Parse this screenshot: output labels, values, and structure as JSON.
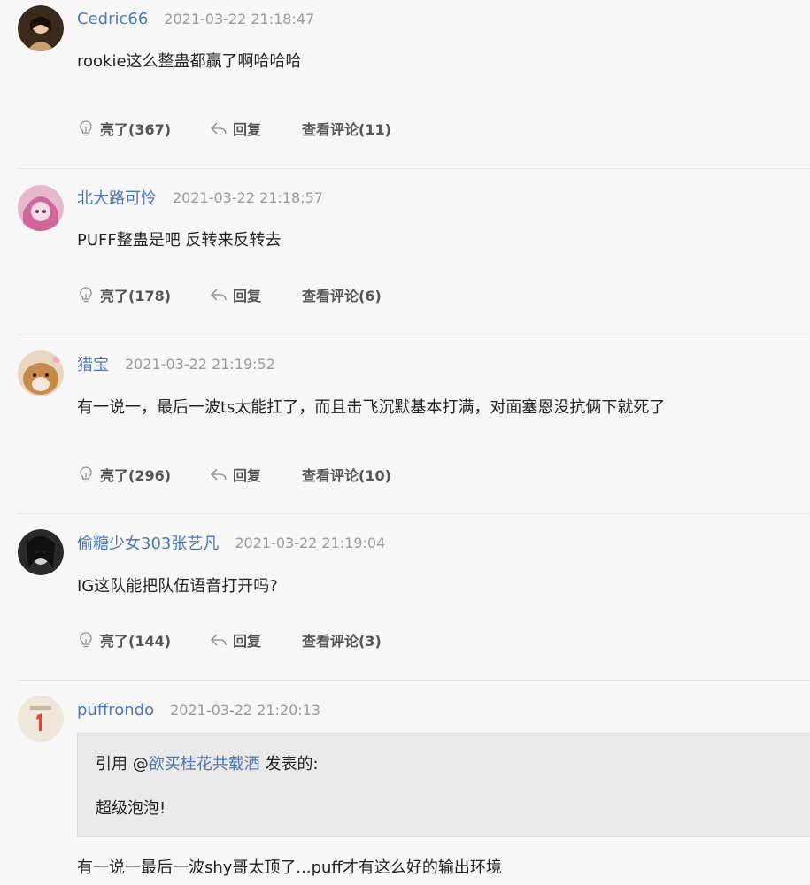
{
  "comments": [
    {
      "username": "Cedric66",
      "time": "2021-03-22 21:18:47",
      "text": "rookie这么整蛊都赢了啊哈哈哈",
      "like_label": "亮了(367)",
      "reply_label": "回复",
      "view_label": "查看评论(11)"
    },
    {
      "username": "北大路可怜",
      "time": "2021-03-22 21:18:57",
      "text": "PUFF整蛊是吧 反转来反转去",
      "like_label": "亮了(178)",
      "reply_label": "回复",
      "view_label": "查看评论(6)"
    },
    {
      "username": "猎宝",
      "time": "2021-03-22 21:19:52",
      "text": "有一说一，最后一波ts太能扛了，而且击飞沉默基本打满，对面塞恩没抗俩下就死了",
      "like_label": "亮了(296)",
      "reply_label": "回复",
      "view_label": "查看评论(10)"
    },
    {
      "username": "偷糖少女303张艺凡",
      "time": "2021-03-22 21:19:04",
      "text": "IG这队能把队伍语音打开吗?",
      "like_label": "亮了(144)",
      "reply_label": "回复",
      "view_label": "查看评论(3)"
    },
    {
      "username": "puffrondo",
      "time": "2021-03-22 21:20:13",
      "text": "有一说一最后一波shy哥太顶了...puff才有这么好的输出环境",
      "quote": {
        "prefix": "引用 @",
        "user": "欲买桂花共载酒",
        "suffix": " 发表的:",
        "text": "超级泡泡!"
      }
    }
  ],
  "icons": {
    "like": "lightbulb-icon",
    "reply": "reply-arrow-icon"
  },
  "colors": {
    "username": "#4a7ab8",
    "timestamp": "#9a9a9a",
    "background": "#f7f7f7",
    "quote_background": "#e9e9e9"
  }
}
